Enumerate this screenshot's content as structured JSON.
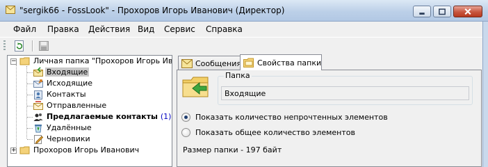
{
  "window": {
    "title": "\"sergik66 - FossLook\" - Прохоров Игорь Иванович (Директор)"
  },
  "menu": [
    "Файл",
    "Правка",
    "Действия",
    "Вид",
    "Сервис",
    "Справка"
  ],
  "tree": {
    "root_label": "Личная папка \"Прохоров Игорь Ивано",
    "items": [
      {
        "label": "Входящие"
      },
      {
        "label": "Исходящие"
      },
      {
        "label": "Контакты"
      },
      {
        "label": "Отправленные"
      },
      {
        "label": "Предлагаемые контакты",
        "count": "(1)"
      },
      {
        "label": "Удалённые"
      },
      {
        "label": "Черновики"
      }
    ],
    "second_root_label": "Прохоров Игорь Иванович"
  },
  "tabs": [
    {
      "label": "Сообщения"
    },
    {
      "label": "Свойства папки"
    }
  ],
  "properties": {
    "group_title": "Папка",
    "folder_name": "Входящие",
    "radio_unread": "Показать количество непрочтенных элементов",
    "radio_total": "Показать общее количество элементов",
    "selected_radio": "unread",
    "folder_size": "Размер папки - 197 байт"
  },
  "colors": {
    "title_bar": "#bcd0e8",
    "selection": "#c8c8c8",
    "count_text": "#0000c0"
  }
}
